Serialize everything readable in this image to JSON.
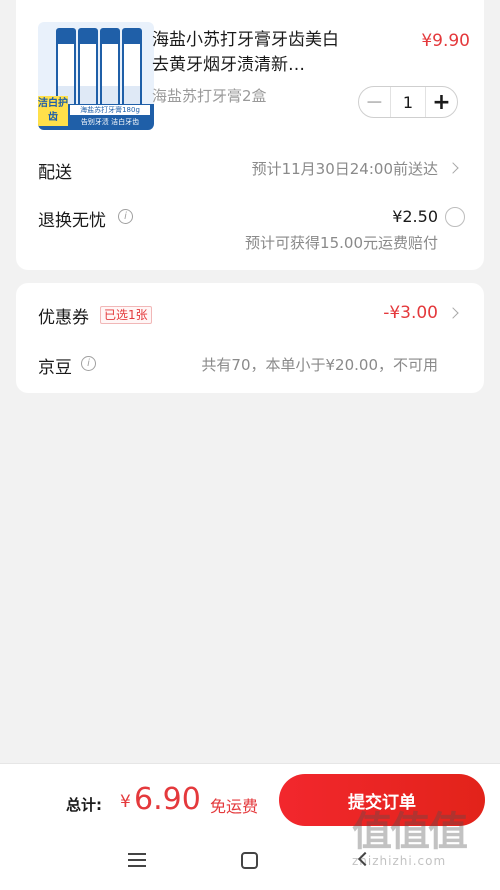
{
  "product": {
    "title": "海盐小苏打牙膏牙齿美白去黄牙烟牙渍清新…",
    "price": "¥9.90",
    "spec": "海盐苏打牙膏2盒",
    "quantity": "1",
    "image_badge": "洁白护齿",
    "image_strip_1": "海盐苏打牙膏180g",
    "image_strip_2": "告别牙渍 洁白牙齿"
  },
  "delivery": {
    "label": "配送",
    "value": "预计11月30日24:00前送达"
  },
  "return_worry_free": {
    "label": "退换无忧",
    "price": "¥2.50",
    "note": "预计可获得15.00元运费赔付"
  },
  "coupon": {
    "label": "优惠券",
    "tag": "已选1张",
    "value": "-¥3.00"
  },
  "jingdou": {
    "label": "京豆",
    "note": "共有70，本单小于¥20.00，不可用"
  },
  "footer": {
    "total_label": "总计:",
    "currency": "¥",
    "total_value": "6.90",
    "free_shipping": "免运费",
    "submit_label": "提交订单"
  },
  "watermark": {
    "logo": "值值值",
    "url": "zhizhizhi.com"
  },
  "colors": {
    "accent": "#e4393c",
    "page_bg": "#f2f2f2"
  }
}
